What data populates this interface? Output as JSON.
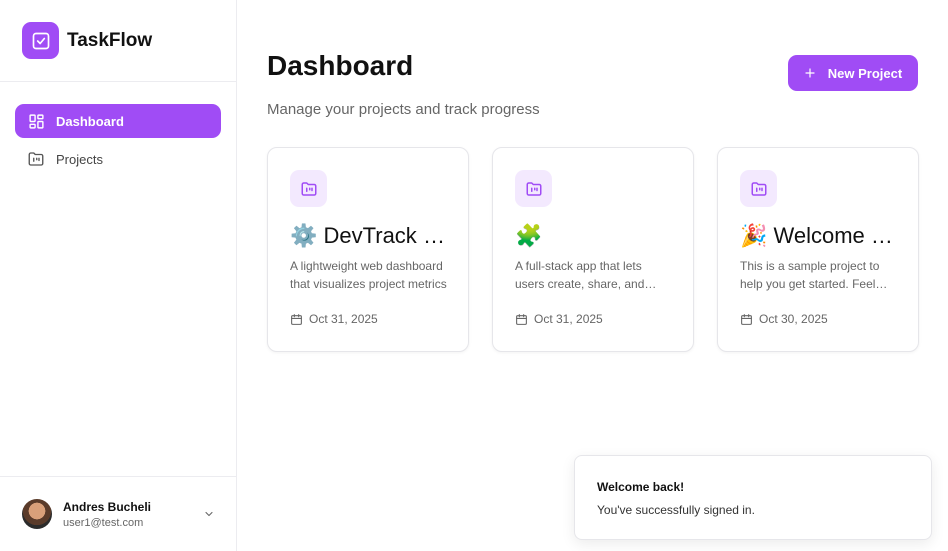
{
  "brand": {
    "name": "TaskFlow",
    "logo_icon": "check-square-icon",
    "accent": "#a04cf5"
  },
  "sidebar": {
    "items": [
      {
        "label": "Dashboard",
        "icon": "layout-grid-icon",
        "active": true
      },
      {
        "label": "Projects",
        "icon": "folder-icon",
        "active": false
      }
    ]
  },
  "user": {
    "name": "Andres Bucheli",
    "email": "user1@test.com"
  },
  "header": {
    "title": "Dashboard",
    "subtitle": "Manage your projects and track progress",
    "new_button_label": "New Project"
  },
  "projects": [
    {
      "title": "⚙️ DevTrack Dashboard",
      "description": "A lightweight web dashboard that visualizes project metrics",
      "date": "Oct 31, 2025"
    },
    {
      "title": "🧩 ",
      "description": "A full-stack app that lets users create, share, and collaborate",
      "date": "Oct 31, 2025"
    },
    {
      "title": "🎉 Welcome to TaskFlow",
      "description": "This is a sample project to help you get started. Feel free to explore",
      "date": "Oct 30, 2025"
    }
  ],
  "toast": {
    "title": "Welcome back!",
    "message": "You've successfully signed in."
  },
  "colors": {
    "accent": "#a04cf5",
    "accent_soft": "#f3e9fe"
  }
}
